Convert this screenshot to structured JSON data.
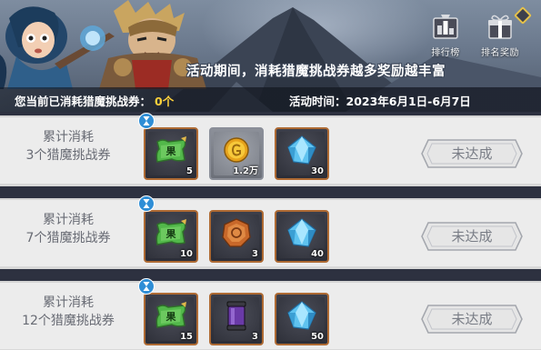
{
  "banner": {
    "promo_text": "活动期间，消耗猎魔挑战券越多奖励越丰富",
    "buttons": [
      {
        "label": "排行榜",
        "icon": "leaderboard-icon"
      },
      {
        "label": "排名奖励",
        "icon": "gift-icon"
      }
    ],
    "consumed_label": "您当前已消耗猎魔挑战券：",
    "consumed_value": "0个",
    "period_text": "活动时间：2023年6月1日-6月7日"
  },
  "rows": [
    {
      "title_line1": "累计消耗",
      "title_line2": "3个猎魔挑战券",
      "status_label": "未达成",
      "rewards": [
        {
          "icon": "fruit-ticket-icon",
          "qty": "5"
        },
        {
          "icon": "gold-coin-icon",
          "qty": "1.2万"
        },
        {
          "icon": "blue-crystal-icon",
          "qty": "30"
        }
      ]
    },
    {
      "title_line1": "累计消耗",
      "title_line2": "7个猎魔挑战券",
      "status_label": "未达成",
      "rewards": [
        {
          "icon": "fruit-ticket-icon",
          "qty": "10"
        },
        {
          "icon": "bronze-emblem-icon",
          "qty": "3"
        },
        {
          "icon": "blue-crystal-icon",
          "qty": "40"
        }
      ]
    },
    {
      "title_line1": "累计消耗",
      "title_line2": "12个猎魔挑战券",
      "status_label": "未达成",
      "rewards": [
        {
          "icon": "fruit-ticket-icon",
          "qty": "15"
        },
        {
          "icon": "purple-potion-jar-icon",
          "qty": "3"
        },
        {
          "icon": "blue-crystal-icon",
          "qty": "50"
        }
      ]
    }
  ],
  "ticket_glyph": "果",
  "colors": {
    "accent_yellow": "#ffd23b",
    "item_border_orange": "#ae6a33",
    "row_background": "#ececec"
  }
}
